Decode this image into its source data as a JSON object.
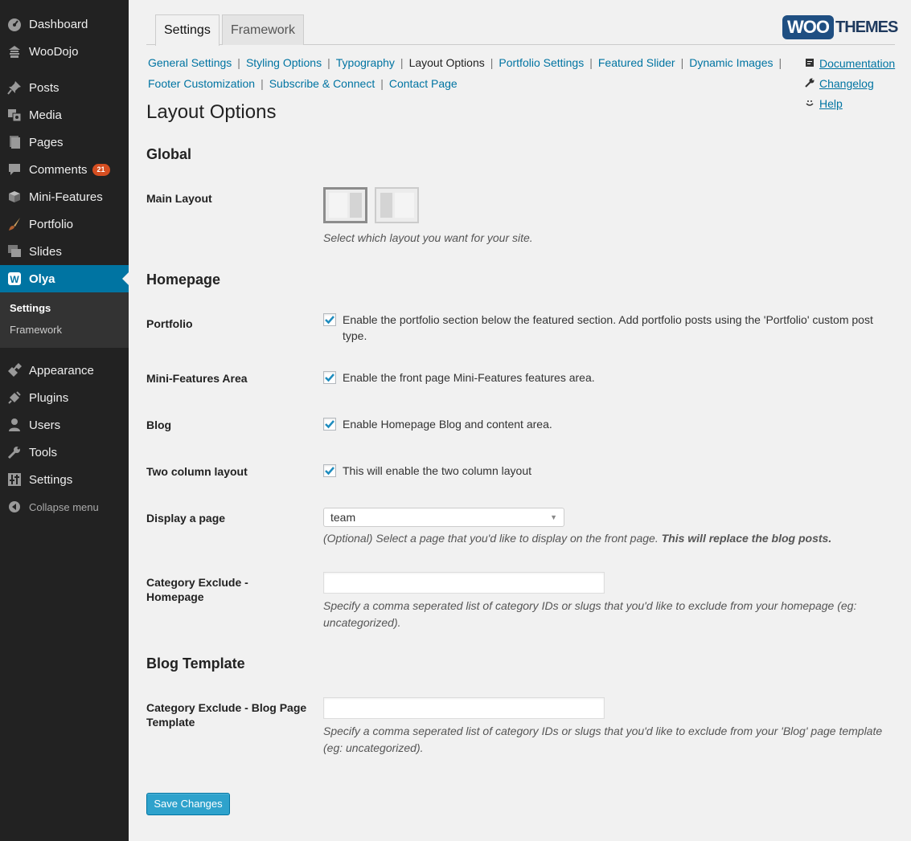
{
  "sidebar": {
    "items": [
      {
        "label": "Dashboard",
        "icon": "dashboard-icon"
      },
      {
        "label": "WooDojo",
        "icon": "woodojo-icon"
      },
      {
        "label": "Posts",
        "icon": "pin-icon"
      },
      {
        "label": "Media",
        "icon": "media-icon"
      },
      {
        "label": "Pages",
        "icon": "pages-icon"
      },
      {
        "label": "Comments",
        "icon": "comment-icon",
        "badge": "21"
      },
      {
        "label": "Mini-Features",
        "icon": "box-icon"
      },
      {
        "label": "Portfolio",
        "icon": "brush-icon"
      },
      {
        "label": "Slides",
        "icon": "slides-icon"
      },
      {
        "label": "Olya",
        "icon": "woo-w-icon"
      },
      {
        "label": "Appearance",
        "icon": "appearance-icon"
      },
      {
        "label": "Plugins",
        "icon": "plugins-icon"
      },
      {
        "label": "Users",
        "icon": "users-icon"
      },
      {
        "label": "Tools",
        "icon": "wrench-icon"
      },
      {
        "label": "Settings",
        "icon": "sliders-icon"
      }
    ],
    "submenu": [
      {
        "label": "Settings"
      },
      {
        "label": "Framework"
      }
    ],
    "collapse_label": "Collapse menu"
  },
  "tabs": [
    {
      "label": "Settings"
    },
    {
      "label": "Framework"
    }
  ],
  "logo": {
    "woo": "WOO",
    "themes": "THEMES"
  },
  "subnav": [
    "General Settings",
    "Styling Options",
    "Typography",
    "Layout Options",
    "Portfolio Settings",
    "Featured Slider",
    "Dynamic Images",
    "Footer Customization",
    "Subscribe & Connect",
    "Contact Page"
  ],
  "help_links": [
    {
      "label": "Documentation",
      "icon": "document-icon"
    },
    {
      "label": "Changelog",
      "icon": "wrench-icon"
    },
    {
      "label": "Help",
      "icon": "smile-icon"
    }
  ],
  "page_title": "Layout Options",
  "sections": {
    "global": "Global",
    "homepage": "Homepage",
    "blog_template": "Blog Template"
  },
  "fields": {
    "main_layout": {
      "label": "Main Layout",
      "desc": "Select which layout you want for your site."
    },
    "portfolio": {
      "label": "Portfolio",
      "text": "Enable the portfolio section below the featured section. Add portfolio posts using the 'Portfolio' custom post type.",
      "checked": true
    },
    "mini_features": {
      "label": "Mini-Features Area",
      "text": "Enable the front page Mini-Features features area.",
      "checked": true
    },
    "blog": {
      "label": "Blog",
      "text": "Enable Homepage Blog and content area.",
      "checked": true
    },
    "two_column": {
      "label": "Two column layout",
      "text": "This will enable the two column layout",
      "checked": true
    },
    "display_page": {
      "label": "Display a page",
      "value": "team",
      "desc": "(Optional) Select a page that you'd like to display on the front page.",
      "desc_bold": "This will replace the blog posts."
    },
    "cat_exclude_home": {
      "label": "Category Exclude - Homepage",
      "value": "",
      "desc": "Specify a comma seperated list of category IDs or slugs that you'd like to exclude from your homepage (eg: uncategorized)."
    },
    "cat_exclude_blog": {
      "label": "Category Exclude - Blog Page Template",
      "value": "",
      "desc": "Specify a comma seperated list of category IDs or slugs that you'd like to exclude from your 'Blog' page template (eg: uncategorized)."
    }
  },
  "save_label": "Save Changes",
  "colors": {
    "accent": "#0074a2",
    "button": "#2ea2cc",
    "sidebar": "#222222",
    "badge": "#d54e21"
  }
}
